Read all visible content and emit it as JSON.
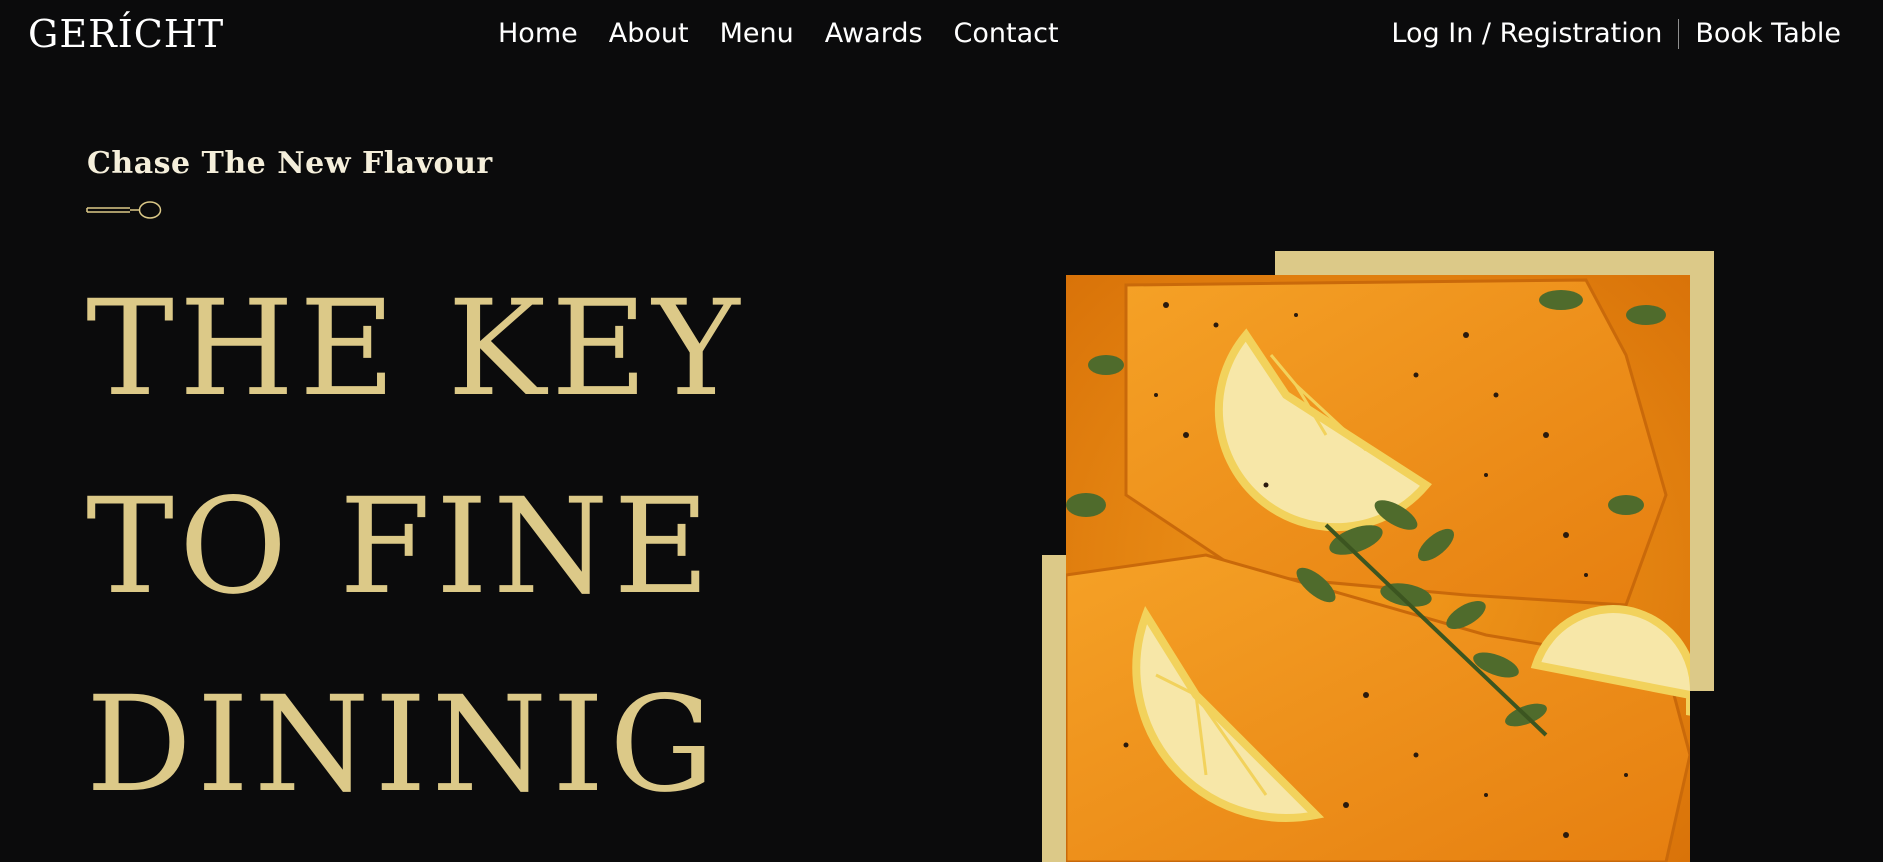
{
  "navbar": {
    "logo": "GERÍCHT",
    "links": [
      "Home",
      "About",
      "Menu",
      "Awards",
      "Contact"
    ],
    "login": "Log In / Registration",
    "book_table": "Book Table"
  },
  "hero": {
    "subtitle": "Chase The New Flavour",
    "headline_lines": [
      "THE KEY",
      "TO FINE",
      "DININIG"
    ],
    "accent_color": "#dcc988",
    "background_color": "#0b0b0c",
    "decor_icon": "spoon-icon",
    "image_description_icon": "food-image"
  }
}
